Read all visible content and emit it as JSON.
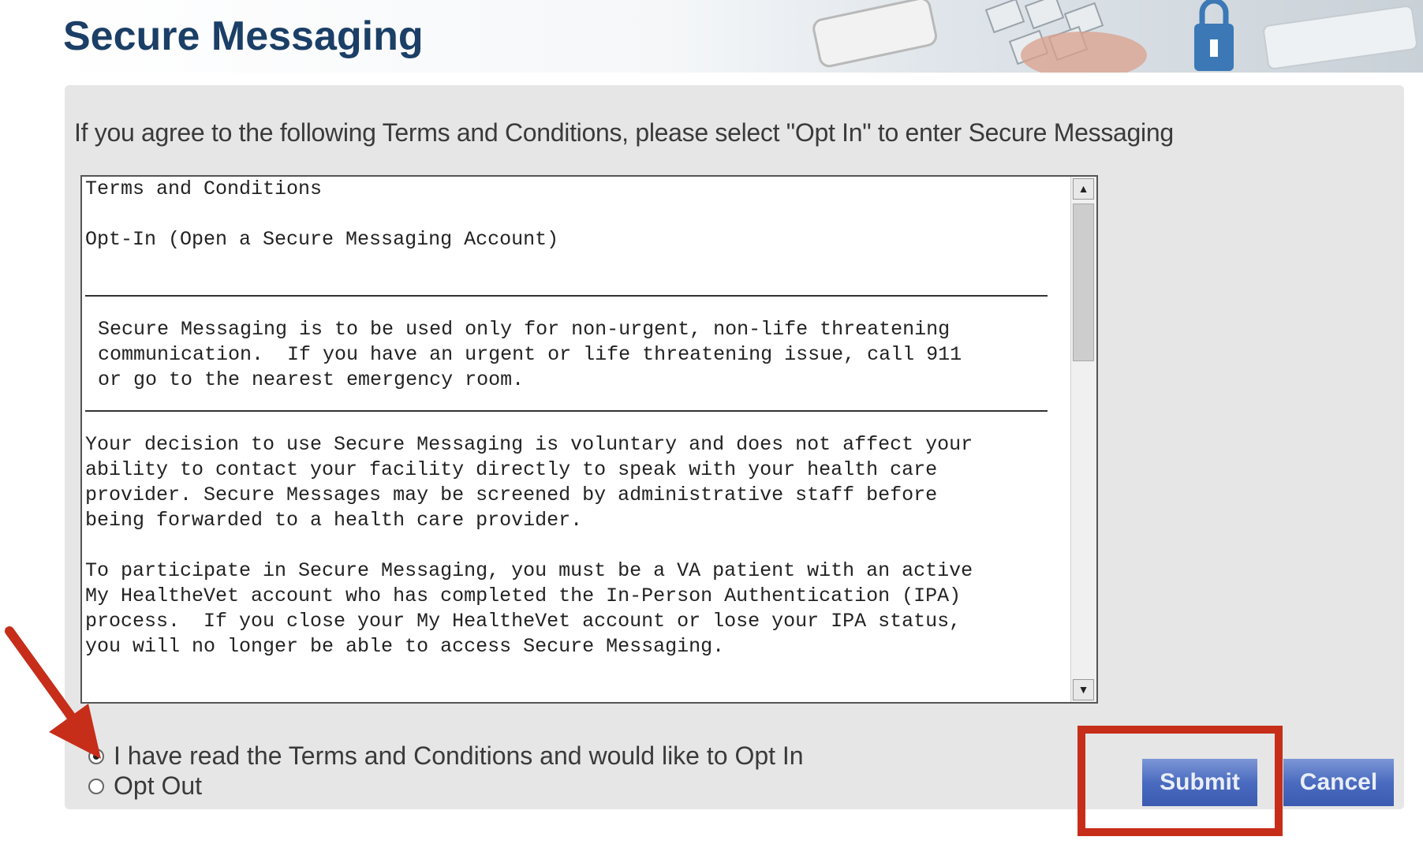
{
  "header": {
    "title": "Secure Messaging"
  },
  "instruction": "If you agree to the following Terms and Conditions, please select \"Opt In\" to enter Secure Messaging",
  "terms": {
    "heading": "Terms and Conditions",
    "subheading": "Opt-In (Open a Secure Messaging Account)",
    "notice": [
      "Secure Messaging is to be used only for non-urgent, non-life threatening",
      "communication.  If you have an urgent or life threatening issue, call 911",
      "or go to the nearest emergency room."
    ],
    "para1": [
      "Your decision to use Secure Messaging is voluntary and does not affect your",
      "ability to contact your facility directly to speak with your health care",
      "provider. Secure Messages may be screened by administrative staff before",
      "being forwarded to a health care provider."
    ],
    "para2": [
      "To participate in Secure Messaging, you must be a VA patient with an active",
      "My HealtheVet account who has completed the In-Person Authentication (IPA)",
      "process.  If you close your My HealtheVet account or lose your IPA status,",
      "you will no longer be able to access Secure Messaging."
    ]
  },
  "options": {
    "opt_in_label": "I have read the Terms and Conditions and would like to Opt In",
    "opt_out_label": "Opt Out",
    "selected": "opt_in"
  },
  "buttons": {
    "submit": "Submit",
    "cancel": "Cancel"
  },
  "colors": {
    "title": "#1b3f66",
    "button": "#4a6bbf",
    "annotation": "#c62e1a"
  }
}
